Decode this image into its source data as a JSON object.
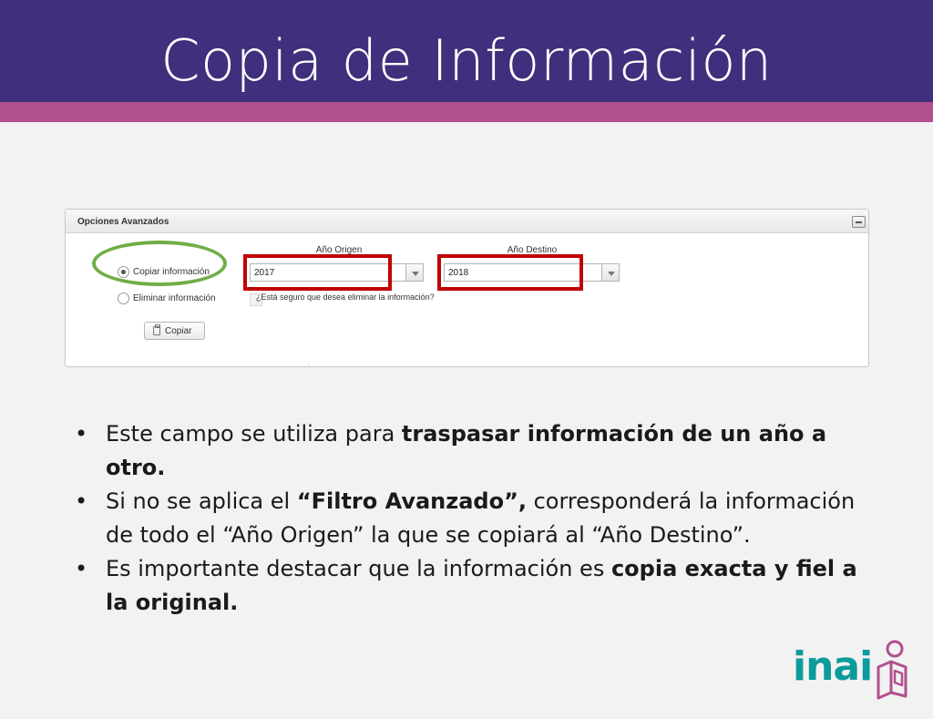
{
  "slide": {
    "title": "Copia de Información"
  },
  "panel": {
    "title": "Opciones Avanzados",
    "options": [
      {
        "label": "Copiar información",
        "selected": true
      },
      {
        "label": "Eliminar información",
        "selected": false
      }
    ],
    "origin": {
      "label": "Año Origen",
      "value": "2017"
    },
    "destination": {
      "label": "Año Destino",
      "value": "2018"
    },
    "confirm_label": "¿Está seguro que desea eliminar la información?",
    "copy_button": "Copiar"
  },
  "bullets": [
    {
      "parts": [
        {
          "text": "Este campo se utiliza para ",
          "bold": false
        },
        {
          "text": "traspasar información de un año a otro.",
          "bold": true
        }
      ]
    },
    {
      "parts": [
        {
          "text": "Si no se aplica el ",
          "bold": false
        },
        {
          "text": "“Filtro Avanzado”,",
          "bold": true
        },
        {
          "text": " corresponderá la información de todo el “Año Origen” la que se copiará al “Año Destino”.",
          "bold": false
        }
      ]
    },
    {
      "parts": [
        {
          "text": "Es importante destacar que la información es ",
          "bold": false
        },
        {
          "text": "copia exacta y fiel a la original.",
          "bold": true
        }
      ]
    }
  ],
  "logo": {
    "text": "inai"
  },
  "colors": {
    "header": "#3f2f7d",
    "stripe": "#b0508e",
    "highlight_red": "#c00000",
    "highlight_green": "#70ad47",
    "logo": "#0c9b9b"
  }
}
